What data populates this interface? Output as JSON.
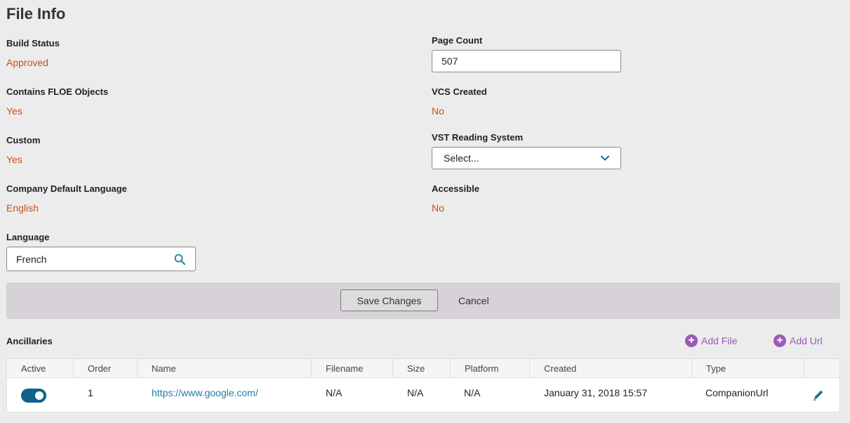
{
  "page": {
    "title": "File Info"
  },
  "fields": {
    "build_status": {
      "label": "Build Status",
      "value": "Approved"
    },
    "contains_floe": {
      "label": "Contains FLOE Objects",
      "value": "Yes"
    },
    "custom": {
      "label": "Custom",
      "value": "Yes"
    },
    "company_default_language": {
      "label": "Company Default Language",
      "value": "English"
    },
    "language": {
      "label": "Language",
      "value": "French"
    },
    "page_count": {
      "label": "Page Count",
      "value": "507"
    },
    "vcs_created": {
      "label": "VCS Created",
      "value": "No"
    },
    "vst_reading_system": {
      "label": "VST Reading System",
      "value": "Select..."
    },
    "accessible": {
      "label": "Accessible",
      "value": "No"
    }
  },
  "actions": {
    "save_label": "Save Changes",
    "cancel_label": "Cancel"
  },
  "ancillaries": {
    "title": "Ancillaries",
    "add_file_label": "Add File",
    "add_url_label": "Add Url",
    "columns": [
      "Active",
      "Order",
      "Name",
      "Filename",
      "Size",
      "Platform",
      "Created",
      "Type"
    ],
    "rows": [
      {
        "active": true,
        "order": "1",
        "name": "https://www.google.com/",
        "filename": "N/A",
        "size": "N/A",
        "platform": "N/A",
        "created": "January 31, 2018 15:57",
        "type": "CompanionUrl"
      }
    ]
  },
  "colors": {
    "value_accent": "#c8501e",
    "toggle_on": "#0f6289",
    "link": "#1a7fa8",
    "add_link": "#9a5ab8"
  },
  "icons": {
    "language": "search-icon",
    "vst_select": "chevron-down-icon",
    "row_edit": "pencil-icon",
    "add": "plus-circle-icon"
  }
}
